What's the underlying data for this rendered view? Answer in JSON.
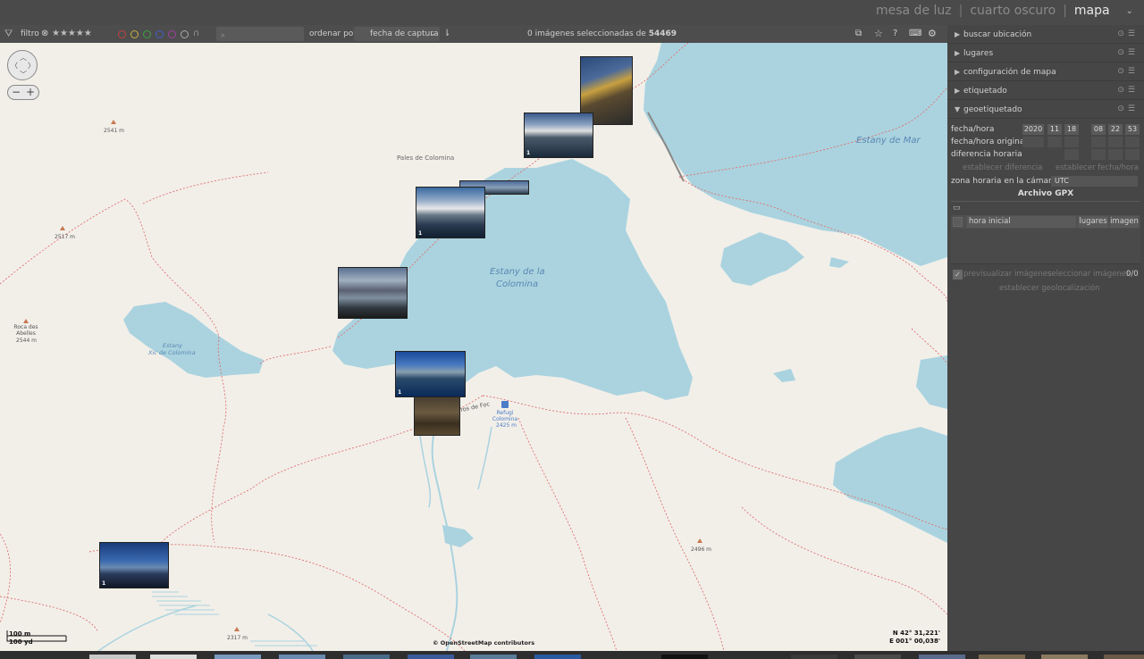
{
  "views": {
    "lighttable": "mesa de luz",
    "darkroom": "cuarto oscuro",
    "map": "mapa",
    "sep": "|",
    "chevron": "chevron-down-icon"
  },
  "toolbar": {
    "filter_label": "filtro",
    "filter_icon": "funnel-icon",
    "stars": "★★★★★",
    "sort_label": "ordenar por",
    "sort_value": "fecha de captura",
    "selection_prefix": "0 imágenes seleccionadas de",
    "selection_total": "54469",
    "color_labels": [
      "#c64040",
      "#c8b040",
      "#40a040",
      "#4060c8",
      "#a040a0"
    ]
  },
  "map": {
    "labels": {
      "pales": "Pales de Colomina",
      "peak_2541": "2541 m",
      "peak_2517": "2517 m",
      "roca_name": "Roca des Abelles",
      "roca_alt": "2544 m",
      "peak_2496": "2496 m",
      "peak_2317": "2317 m",
      "tros": "Tros de Foc",
      "refugi_name": "Refugi Colomina",
      "refugi_alt": "2425 m"
    },
    "water": {
      "mar": "Estany de Mar",
      "colomina_1": "Estany de la",
      "colomina_2": "Colomina",
      "small_1": "Estany",
      "small_2": "Xic de Colomina"
    },
    "attribution": "© OpenStreetMap contributors",
    "coords": {
      "lat": "N 42° 31,221'",
      "lon": "E 001° 00,038'"
    },
    "scale": {
      "m": "100 m",
      "yd": "100 yd"
    },
    "thumb_count": "1"
  },
  "panel": {
    "modules": [
      "buscar ubicación",
      "lugares",
      "configuración de mapa",
      "etiquetado",
      "geoetiquetado"
    ],
    "date_label": "fecha/hora",
    "orig_label": "fecha/hora original",
    "diff_label": "diferencia horaria",
    "date": {
      "year": "2020",
      "month": "11",
      "day": "18",
      "hour": "08",
      "min": "22",
      "sec": "53"
    },
    "set_offset": "establecer diferencia",
    "set_datetime": "establecer fecha/hora",
    "tz_label": "zona horaria en la cámara",
    "tz_value": "UTC",
    "gpx_title": "Archivo GPX",
    "col_start": "hora inicial",
    "col_places": "lugares",
    "col_image": "imagen",
    "preview_label": "previsualizar imágenes",
    "select_images": "seleccionar imágenes",
    "count": "0/0",
    "apply": "establecer geolocalización"
  }
}
